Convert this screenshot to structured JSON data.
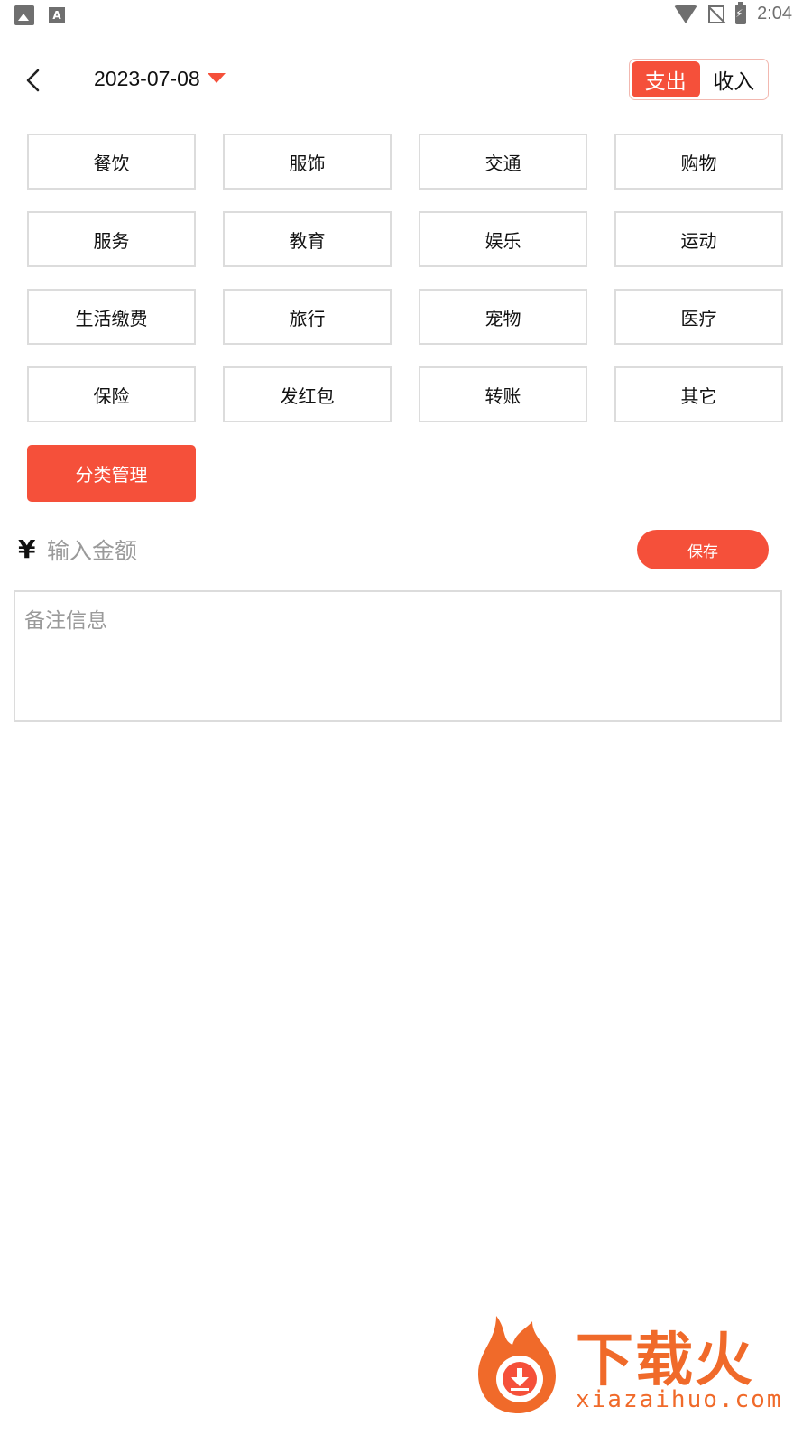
{
  "status_bar": {
    "time": "2:04",
    "icons": [
      "image-icon",
      "font-a-icon",
      "wifi-icon",
      "no-sim-icon",
      "battery-charging-icon"
    ],
    "a_glyph": "A"
  },
  "header": {
    "date": "2023-07-08",
    "toggle": {
      "expense_label": "支出",
      "income_label": "收入",
      "selected": "支出"
    }
  },
  "categories": [
    "餐饮",
    "服饰",
    "交通",
    "购物",
    "服务",
    "教育",
    "娱乐",
    "运动",
    "生活缴费",
    "旅行",
    "宠物",
    "医疗",
    "保险",
    "发红包",
    "转账",
    "其它"
  ],
  "manage_label": "分类管理",
  "amount": {
    "currency_symbol": "¥",
    "placeholder": "输入金额",
    "value": ""
  },
  "save_label": "保存",
  "note": {
    "placeholder": "备注信息",
    "value": ""
  },
  "watermark": {
    "brand": "下载火",
    "domain": "xiazaihuo.com"
  },
  "colors": {
    "accent": "#f5503a",
    "border": "#dcdcdc",
    "placeholder": "#9a9a9a"
  }
}
